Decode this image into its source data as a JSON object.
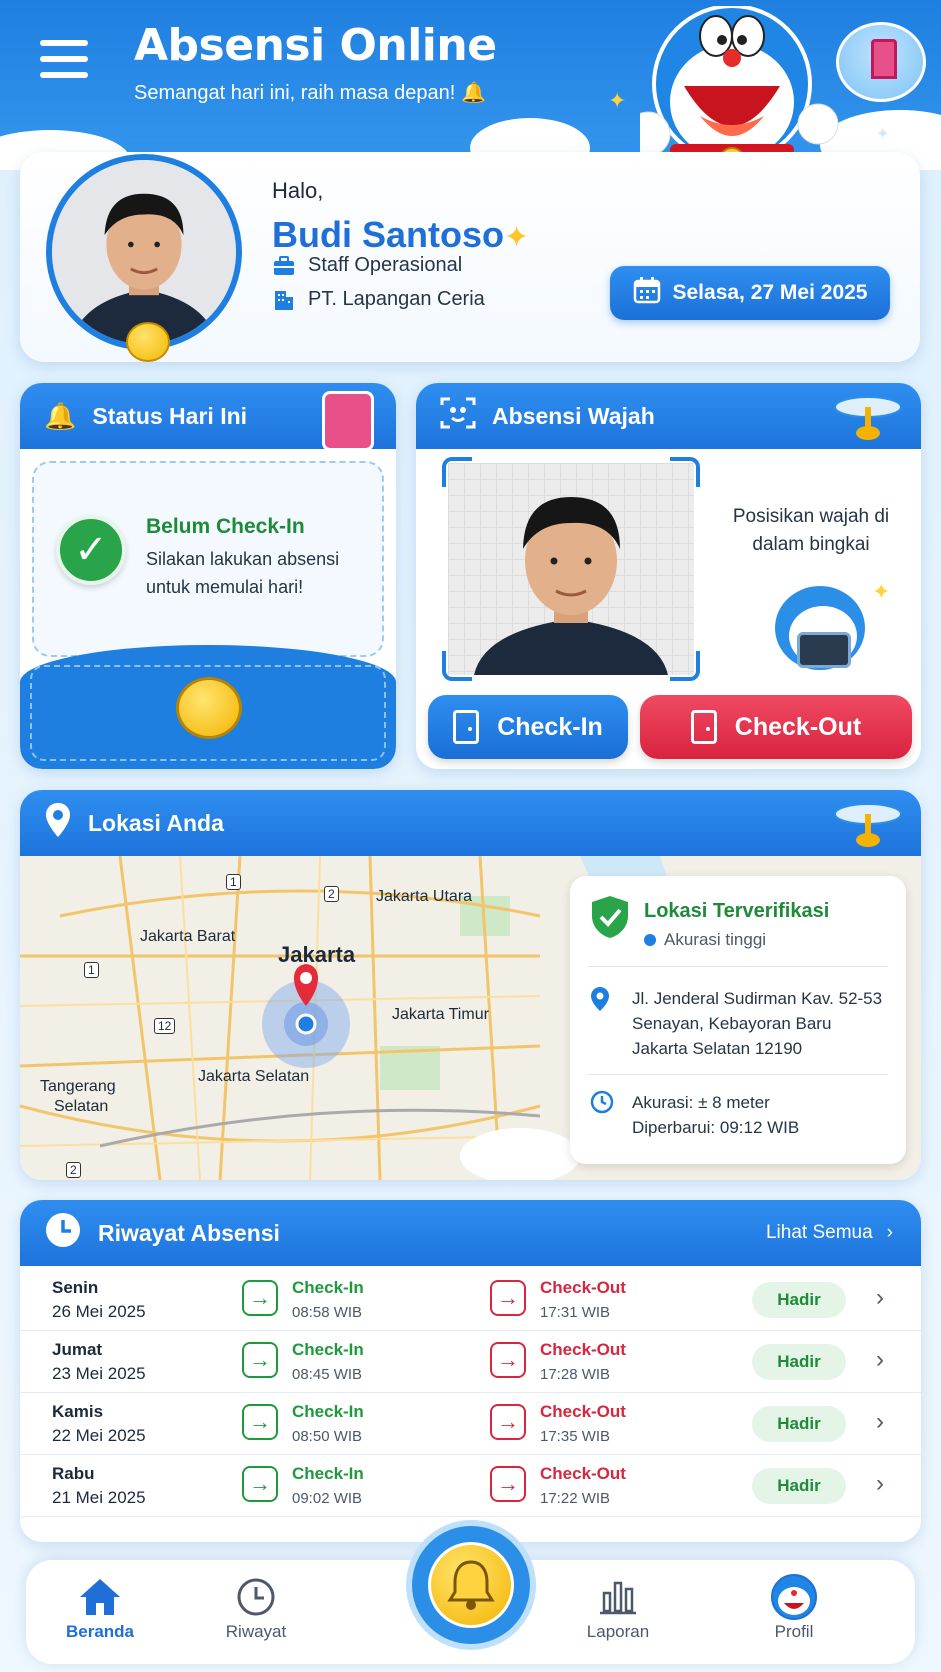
{
  "header": {
    "title": "Absensi Online",
    "subtitle": "Semangat hari ini, raih masa depan!"
  },
  "profile": {
    "greeting": "Halo,",
    "name": "Budi Santoso",
    "role": "Staff Operasional",
    "company": "PT. Lapangan Ceria",
    "date": "Selasa, 27 Mei 2025"
  },
  "status": {
    "heading": "Status Hari Ini",
    "title": "Belum Check-In",
    "desc": "Silakan lakukan absensi untuk memulai hari!"
  },
  "face": {
    "heading": "Absensi Wajah",
    "hint": "Posisikan wajah di dalam bingkai",
    "checkin_label": "Check-In",
    "checkout_label": "Check-Out"
  },
  "location": {
    "heading": "Lokasi Anda",
    "map_labels": {
      "jakarta": "Jakarta",
      "utara": "Jakarta Utara",
      "barat": "Jakarta Barat",
      "timur": "Jakarta Timur",
      "selatan": "Jakarta Selatan",
      "tangerang1": "Tangerang",
      "tangerang2": "Selatan"
    },
    "road_numbers": [
      "1",
      "2",
      "1",
      "12",
      "2"
    ],
    "verified_title": "Lokasi Terverifikasi",
    "verified_sub": "Akurasi tinggi",
    "address_line1": "Jl. Jenderal Sudirman Kav. 52-53",
    "address_line2": "Senayan, Kebayoran Baru",
    "address_line3": "Jakarta Selatan 12190",
    "accuracy": "Akurasi: ± 8 meter",
    "updated": "Diperbarui: 09:12 WIB"
  },
  "history": {
    "heading": "Riwayat Absensi",
    "see_all": "Lihat Semua",
    "rows": [
      {
        "day": "Senin",
        "date": "26 Mei 2025",
        "in_label": "Check-In",
        "in_time": "08:58 WIB",
        "out_label": "Check-Out",
        "out_time": "17:31 WIB",
        "status": "Hadir"
      },
      {
        "day": "Jumat",
        "date": "23 Mei 2025",
        "in_label": "Check-In",
        "in_time": "08:45 WIB",
        "out_label": "Check-Out",
        "out_time": "17:28 WIB",
        "status": "Hadir"
      },
      {
        "day": "Kamis",
        "date": "22 Mei 2025",
        "in_label": "Check-In",
        "in_time": "08:50 WIB",
        "out_label": "Check-Out",
        "out_time": "17:35 WIB",
        "status": "Hadir"
      },
      {
        "day": "Rabu",
        "date": "21 Mei 2025",
        "in_label": "Check-In",
        "in_time": "09:02 WIB",
        "out_label": "Check-Out",
        "out_time": "17:22 WIB",
        "status": "Hadir"
      }
    ]
  },
  "nav": {
    "home": "Beranda",
    "history": "Riwayat",
    "report": "Laporan",
    "profile": "Profil"
  },
  "colors": {
    "primary": "#1f7fe0",
    "success": "#1e8a3a",
    "danger": "#d8263f",
    "accent": "#ffc629"
  },
  "icons": {
    "menu": "menu-icon",
    "bell": "bell-icon",
    "calendar": "calendar-icon",
    "briefcase": "briefcase-icon",
    "building": "building-icon",
    "face_scan": "face-scan-icon",
    "map_pin": "map-pin-icon",
    "clock": "clock-icon",
    "shield_check": "shield-check-icon",
    "home": "home-icon",
    "chart": "bar-chart-icon"
  }
}
